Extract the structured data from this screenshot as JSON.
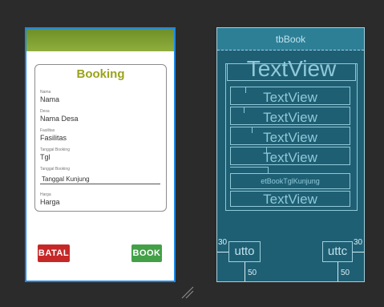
{
  "design": {
    "title": "Booking",
    "fields": [
      {
        "label": "Nama",
        "value": "Nama"
      },
      {
        "label": "Desa",
        "value": "Nama Desa"
      },
      {
        "label": "Fasilitas",
        "value": "Fasilitas"
      },
      {
        "label": "Tanggal Booking",
        "value": "Tgl"
      },
      {
        "label": "Tanggal Booking",
        "value": ""
      },
      {
        "label": "Harga",
        "value": "Harga"
      }
    ],
    "date_input_value": "Tanggal Kunjung",
    "cancel_label": "BATAL",
    "book_label": "BOOK",
    "appbar_color": "#7a9a2e",
    "title_color": "#9aa31a",
    "cancel_color": "#c62828",
    "book_color": "#43a047"
  },
  "blueprint": {
    "toolbar_label": "tbBook",
    "title_text": "TextView",
    "rows": [
      "TextView",
      "TextView",
      "TextView",
      "TextView"
    ],
    "edit_text": "etBookTglKunjung",
    "last_text": "TextView",
    "left_button": "utto",
    "right_button": "uttc",
    "margin_side": "30",
    "margin_bottom": "50"
  }
}
